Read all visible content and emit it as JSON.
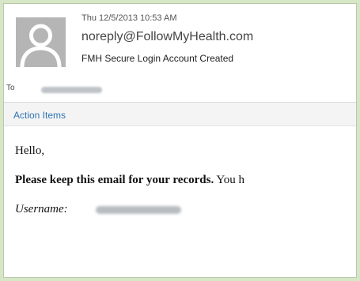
{
  "header": {
    "date": "Thu 12/5/2013 10:53 AM",
    "from": "noreply@FollowMyHealth.com",
    "subject": "FMH Secure Login Account Created",
    "to_label": "To"
  },
  "action_bar": {
    "label": "Action Items"
  },
  "body": {
    "greeting": "Hello,",
    "records_bold": "Please keep this email for your records.",
    "records_rest": " You h",
    "username_label": "Username:"
  },
  "colors": {
    "outer_background": "#d8e6c8",
    "link_blue": "#2f74b5",
    "avatar_gray": "#b5b5b5"
  },
  "icons": {
    "avatar": "person-silhouette-icon"
  }
}
